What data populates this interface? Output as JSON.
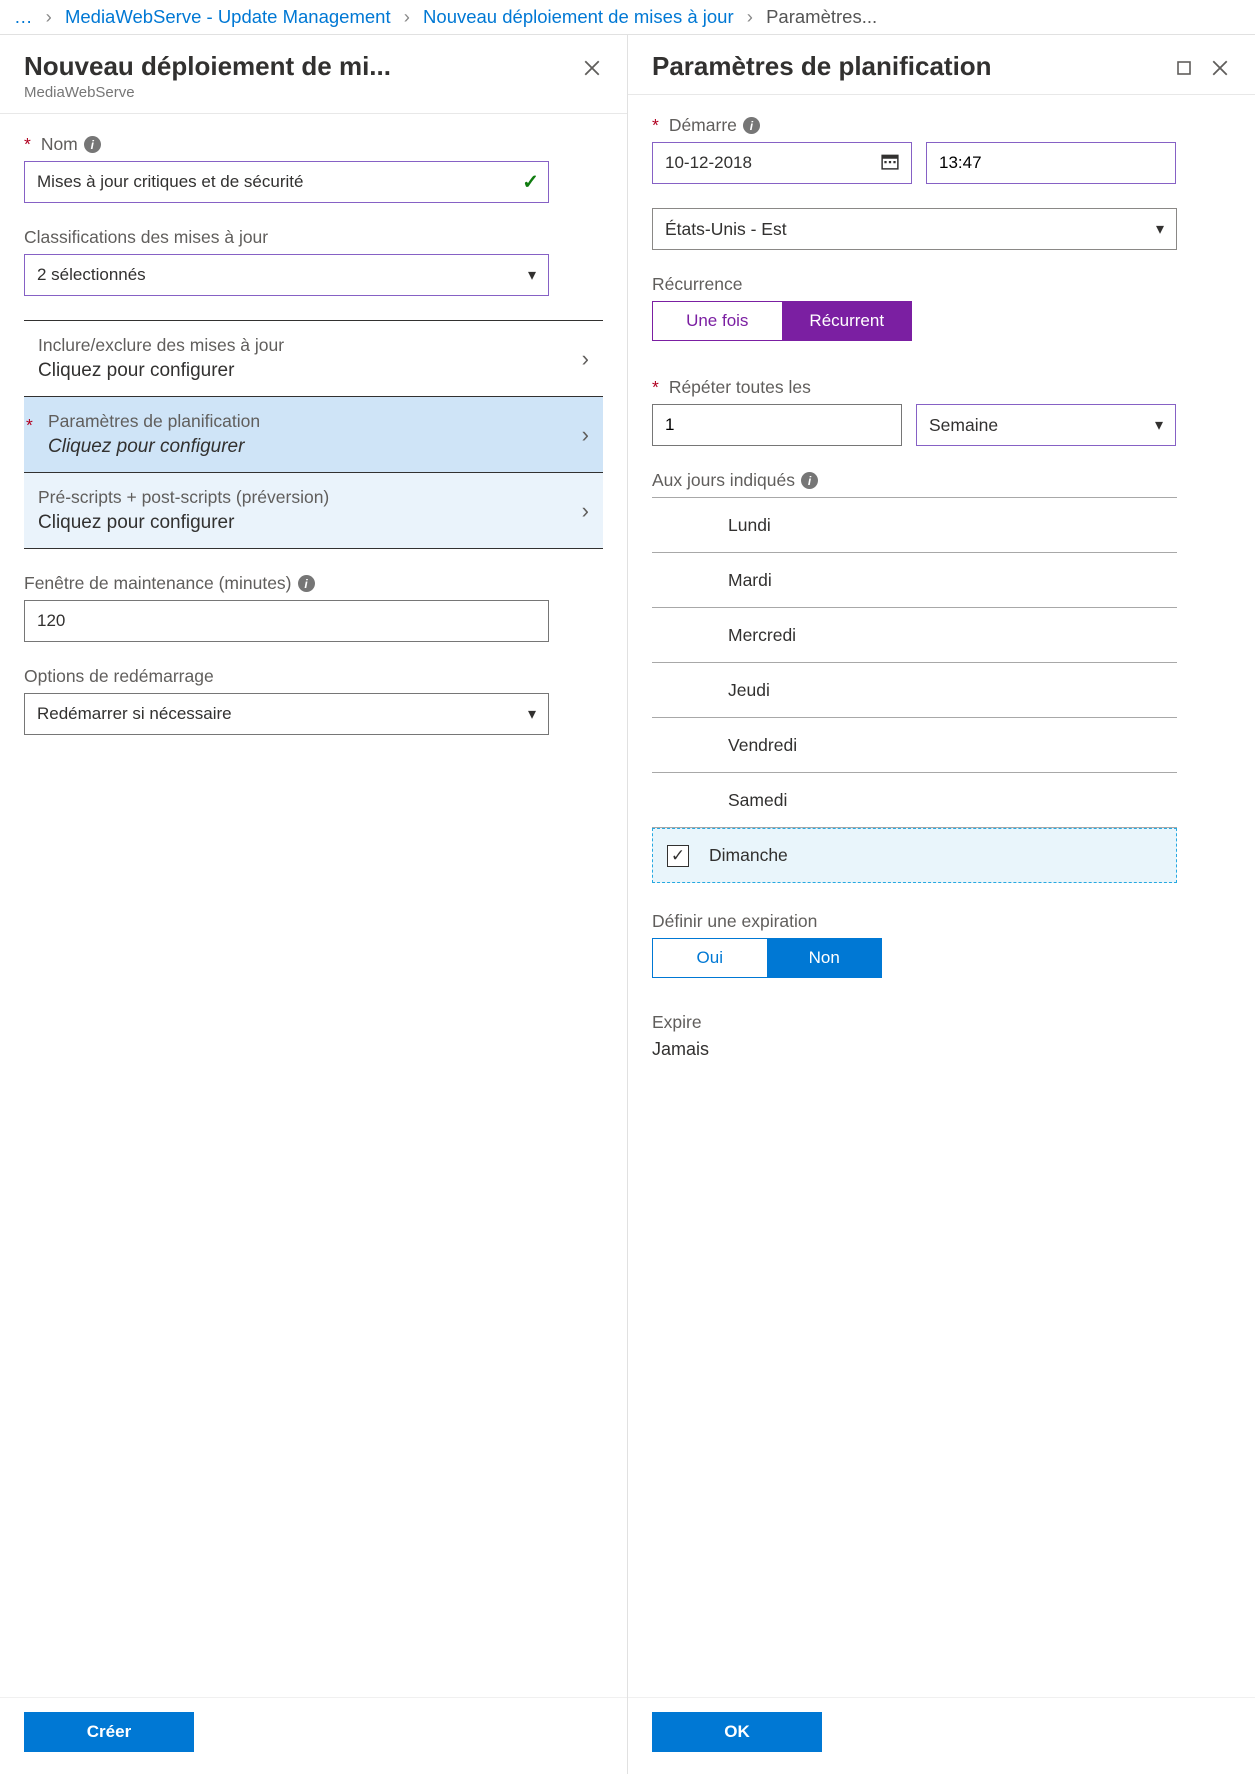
{
  "breadcrumb": {
    "ellipsis": "…",
    "items": [
      "MediaWebServe - Update Management",
      "Nouveau déploiement de mises à jour",
      "Paramètres..."
    ]
  },
  "left": {
    "title": "Nouveau déploiement de mi...",
    "subtitle": "MediaWebServe",
    "name_label": "Nom",
    "name_value": "Mises à jour critiques et de sécurité",
    "class_label": "Classifications des mises à jour",
    "class_value": "2 sélectionnés",
    "rows": {
      "include": {
        "label": "Inclure/exclure des mises à jour",
        "sub": "Cliquez pour configurer"
      },
      "schedule": {
        "label": "Paramètres de planification",
        "sub": "Cliquez pour configurer"
      },
      "scripts": {
        "label": "Pré-scripts + post-scripts (préversion)",
        "sub": "Cliquez pour configurer"
      }
    },
    "maint_label": "Fenêtre de maintenance (minutes)",
    "maint_value": "120",
    "reboot_label": "Options de redémarrage",
    "reboot_value": "Redémarrer si nécessaire",
    "create_btn": "Créer"
  },
  "right": {
    "title": "Paramètres de planification",
    "start_label": "Démarre",
    "start_date": "10-12-2018",
    "start_time": "13:47",
    "tz_value": "États-Unis - Est",
    "recur_label": "Récurrence",
    "recur_once": "Une fois",
    "recur_recurrent": "Récurrent",
    "repeat_label": "Répéter toutes les",
    "repeat_num": "1",
    "repeat_unit": "Semaine",
    "days_label": "Aux jours indiqués",
    "days": [
      "Lundi",
      "Mardi",
      "Mercredi",
      "Jeudi",
      "Vendredi",
      "Samedi",
      "Dimanche"
    ],
    "day_selected_index": 6,
    "exp_label": "Définir une expiration",
    "exp_yes": "Oui",
    "exp_no": "Non",
    "expire_label": "Expire",
    "expire_value": "Jamais",
    "ok_btn": "OK"
  }
}
